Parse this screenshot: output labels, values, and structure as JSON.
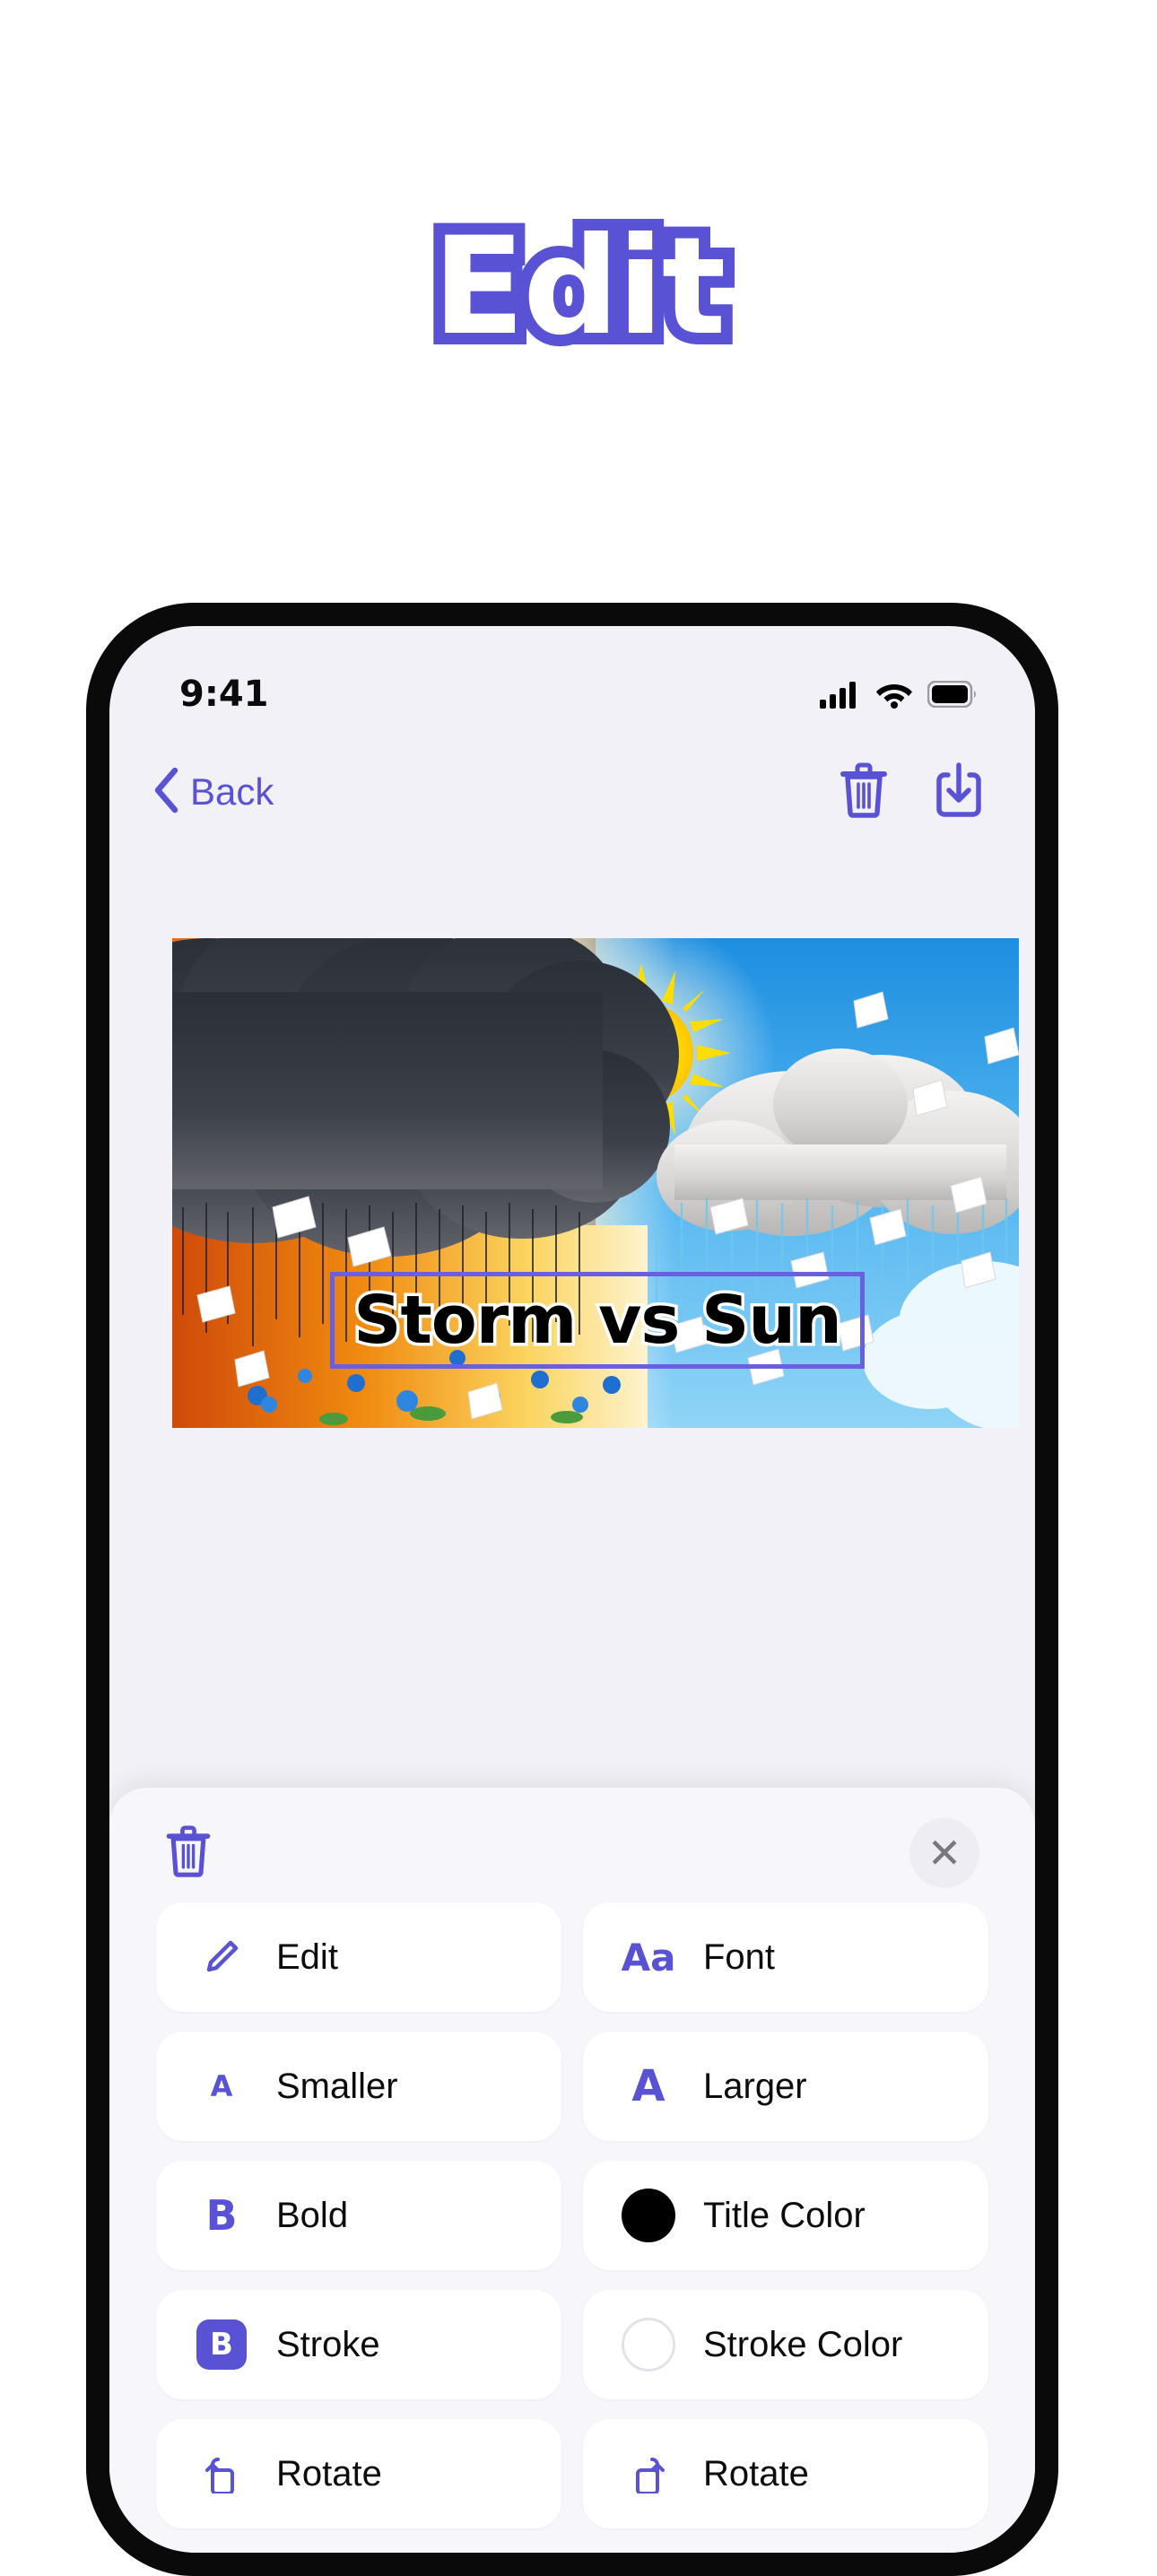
{
  "headline": {
    "text": "Edit"
  },
  "colors": {
    "accent": "#5A52D5",
    "screen_bg": "#F1F1F7",
    "sheet_bg": "#F6F6FB",
    "card_bg": "#FFFFFF",
    "selection_border": "#6A5FE0",
    "title_color_swatch": "#000000",
    "stroke_color_swatch": "#FFFFFF",
    "frame": "#0A0A0A"
  },
  "status_bar": {
    "time": "9:41",
    "icons": [
      "cellular-signal-icon",
      "wifi-icon",
      "battery-icon"
    ]
  },
  "nav_bar": {
    "back_label": "Back",
    "back_icon": "chevron-left-icon",
    "actions": [
      {
        "name": "delete-button",
        "icon": "trash-icon"
      },
      {
        "name": "save-button",
        "icon": "download-icon"
      }
    ]
  },
  "canvas": {
    "overlay_text": "Storm vs Sun",
    "selected": true
  },
  "sheet": {
    "delete_icon": "trash-icon",
    "close_label": "✕",
    "options": [
      {
        "icon": "pencil-icon",
        "label": "Edit"
      },
      {
        "icon": "font-aa-icon",
        "label": "Font"
      },
      {
        "icon": "text-smaller-icon",
        "label": "Smaller"
      },
      {
        "icon": "text-larger-icon",
        "label": "Larger"
      },
      {
        "icon": "bold-icon",
        "label": "Bold"
      },
      {
        "icon": "color-swatch-icon",
        "label": "Title Color"
      },
      {
        "icon": "stroke-badge-icon",
        "label": "Stroke"
      },
      {
        "icon": "stroke-swatch-icon",
        "label": "Stroke Color"
      },
      {
        "icon": "rotate-ccw-icon",
        "label": "Rotate"
      },
      {
        "icon": "rotate-cw-icon",
        "label": "Rotate"
      }
    ]
  }
}
